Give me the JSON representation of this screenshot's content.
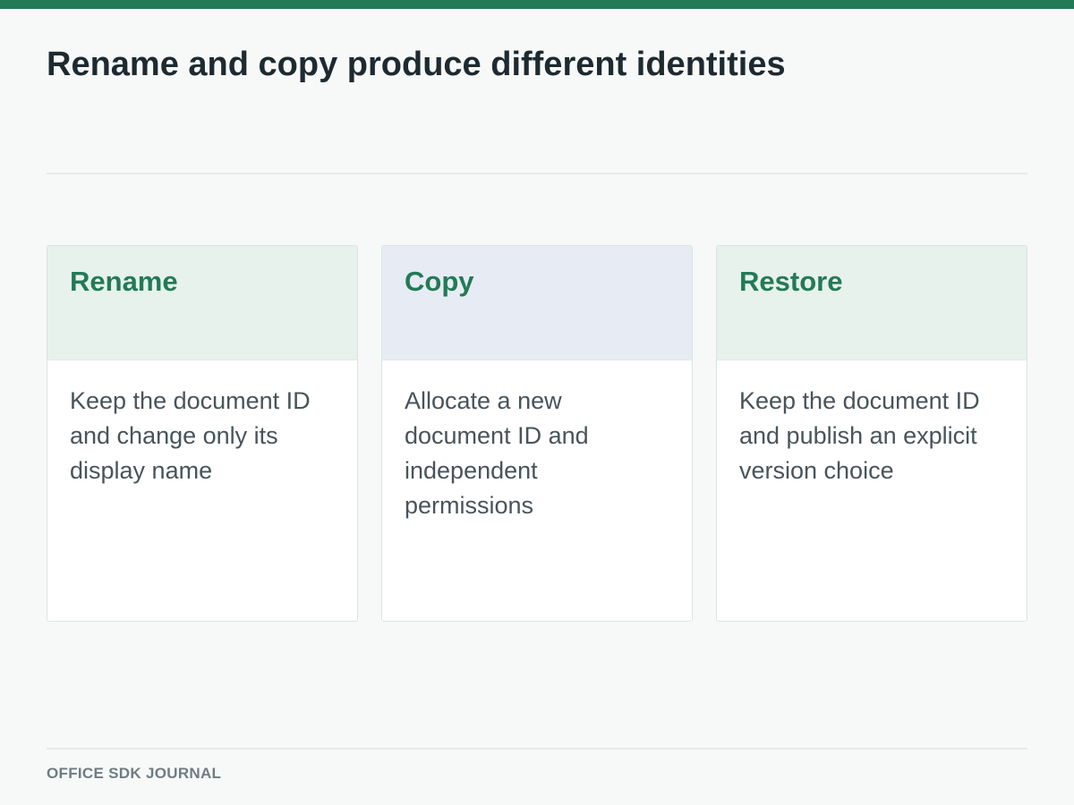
{
  "page": {
    "title": "Rename and copy produce different identities",
    "footer": "OFFICE SDK JOURNAL"
  },
  "cards": [
    {
      "title": "Rename",
      "description": "Keep the document ID and change only its display name",
      "header_color": "#e6f2eb"
    },
    {
      "title": "Copy",
      "description": "Allocate a new document ID and independent permissions",
      "header_color": "#e7ecf4"
    },
    {
      "title": "Restore",
      "description": "Keep the document ID and publish an explicit version choice",
      "header_color": "#e6f2eb"
    }
  ],
  "colors": {
    "accent": "#237a56",
    "background": "#f7f9f8",
    "title_text": "#1e2a30",
    "body_text": "#48545a",
    "footer_text": "#6f7c82"
  }
}
